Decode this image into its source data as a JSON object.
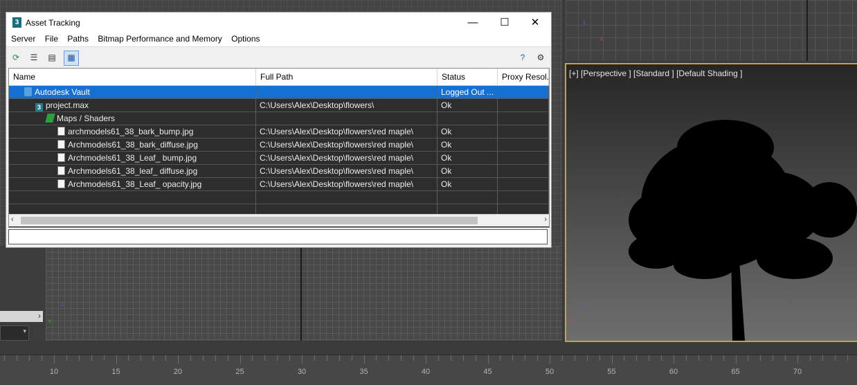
{
  "dialog": {
    "title": "Asset Tracking",
    "app_icon_glyph": "3",
    "window_buttons": {
      "minimize": "—",
      "maximize": "☐",
      "close": "✕"
    },
    "menu": [
      "Server",
      "File",
      "Paths",
      "Bitmap Performance and Memory",
      "Options"
    ],
    "toolbar_icons": [
      "refresh-icon",
      "list-view-icon",
      "detail-view-icon",
      "table-view-icon"
    ],
    "toolbar_right_icons": [
      "help-icon",
      "settings-help-icon"
    ],
    "columns": [
      "Name",
      "Full Path",
      "Status",
      "Proxy Resol..."
    ],
    "rows": [
      {
        "name": "Autodesk Vault",
        "path": "",
        "status": "Logged Out ...",
        "proxy": "",
        "icon": "vault-icon",
        "selected": true
      },
      {
        "name": "project.max",
        "path": "C:\\Users\\Alex\\Desktop\\flowers\\",
        "status": "Ok",
        "proxy": "",
        "icon": "max-file-icon",
        "selected": false
      },
      {
        "name": "Maps / Shaders",
        "path": "",
        "status": "",
        "proxy": "",
        "icon": "maps-icon",
        "selected": false
      },
      {
        "name": "archmodels61_38_bark_bump.jpg",
        "path": "C:\\Users\\Alex\\Desktop\\flowers\\red maple\\",
        "status": "Ok",
        "proxy": "",
        "icon": "image-file-icon",
        "selected": false
      },
      {
        "name": "Archmodels61_38_bark_diffuse.jpg",
        "path": "C:\\Users\\Alex\\Desktop\\flowers\\red maple\\",
        "status": "Ok",
        "proxy": "",
        "icon": "image-file-icon",
        "selected": false
      },
      {
        "name": "Archmodels61_38_Leaf_ bump.jpg",
        "path": "C:\\Users\\Alex\\Desktop\\flowers\\red maple\\",
        "status": "Ok",
        "proxy": "",
        "icon": "image-file-icon",
        "selected": false
      },
      {
        "name": "Archmodels61_38_leaf_ diffuse.jpg",
        "path": "C:\\Users\\Alex\\Desktop\\flowers\\red maple\\",
        "status": "Ok",
        "proxy": "",
        "icon": "image-file-icon",
        "selected": false
      },
      {
        "name": "Archmodels61_38_Leaf_ opacity.jpg",
        "path": "C:\\Users\\Alex\\Desktop\\flowers\\red maple\\",
        "status": "Ok",
        "proxy": "",
        "icon": "image-file-icon",
        "selected": false
      }
    ],
    "status_text": ""
  },
  "viewport": {
    "label": "[+] [Perspective ] [Standard ] [Default Shading ]",
    "active_border_color": "#c8a538"
  },
  "timeline": {
    "labels": [
      "10",
      "15",
      "20",
      "25",
      "30",
      "35",
      "40",
      "45",
      "50",
      "55",
      "60",
      "65",
      "70"
    ]
  },
  "colors": {
    "selection": "#1570d2",
    "tree_bg": "#2d2d2d"
  }
}
